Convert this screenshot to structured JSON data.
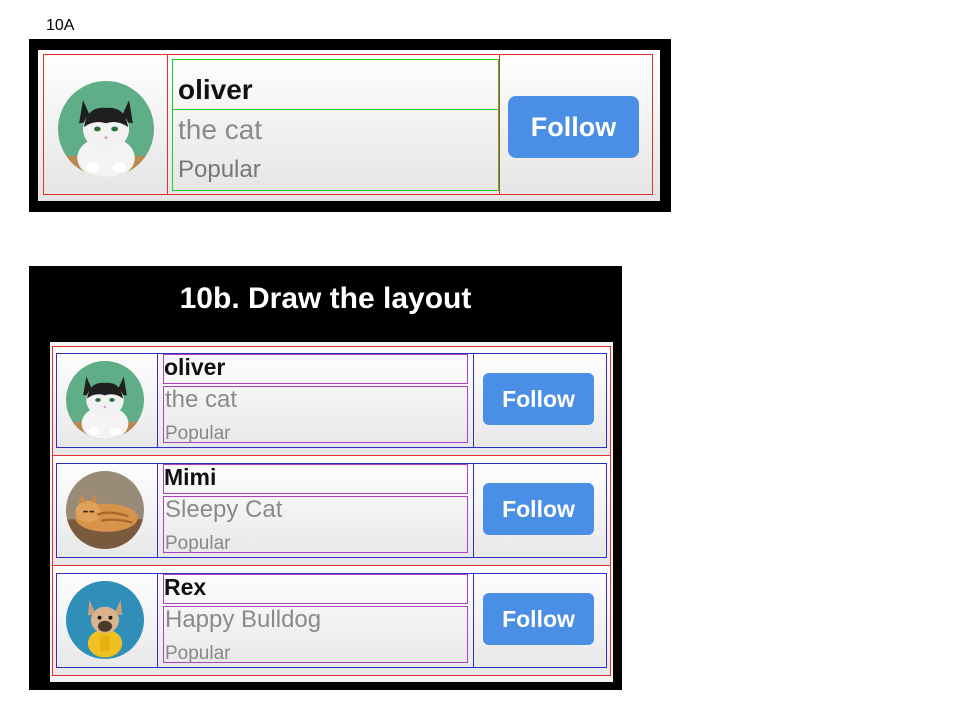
{
  "panel_a": {
    "label": "10A",
    "card": {
      "name": "oliver",
      "subtitle": "the cat",
      "tag": "Popular",
      "follow_label": "Follow",
      "avatar_icon": "cat-avatar-icon"
    }
  },
  "panel_b": {
    "title": "10b. Draw the layout",
    "cards": [
      {
        "name": "oliver",
        "subtitle": "the cat",
        "tag": "Popular",
        "follow_label": "Follow",
        "avatar_icon": "cat-avatar-icon"
      },
      {
        "name": "Mimi",
        "subtitle": "Sleepy Cat",
        "tag": "Popular",
        "follow_label": "Follow",
        "avatar_icon": "cat-avatar-icon"
      },
      {
        "name": "Rex",
        "subtitle": "Happy Bulldog",
        "tag": "Popular",
        "follow_label": "Follow",
        "avatar_icon": "dog-avatar-icon"
      }
    ]
  },
  "colors": {
    "follow_button": "#4a8fe5",
    "layout_outline_red": "#e03030",
    "layout_outline_green": "#22cc22",
    "layout_outline_blue": "#3030c0",
    "layout_outline_magenta": "#b040c0",
    "panel_background": "#000000"
  }
}
